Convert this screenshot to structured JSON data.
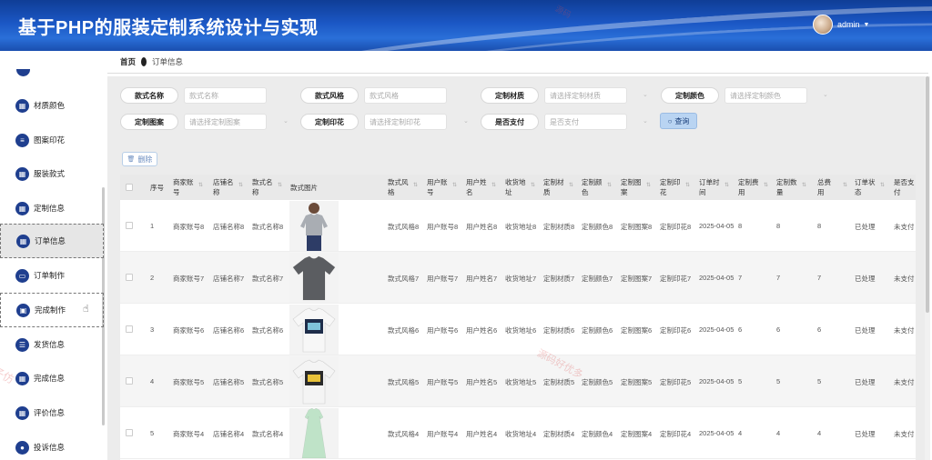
{
  "app": {
    "title": "基于PHP的服装定制系统设计与实现"
  },
  "user": {
    "name": "admin"
  },
  "sidebar": {
    "items": [
      {
        "label": "材质颜色",
        "icon": "grid-icon"
      },
      {
        "label": "图案印花",
        "icon": "list-icon"
      },
      {
        "label": "服装款式",
        "icon": "grid-icon"
      },
      {
        "label": "定制信息",
        "icon": "grid-icon"
      },
      {
        "label": "订单信息",
        "icon": "grid-icon"
      },
      {
        "label": "订单制作",
        "icon": "monitor-icon"
      },
      {
        "label": "完成制作",
        "icon": "clipboard-icon"
      },
      {
        "label": "发货信息",
        "icon": "sliders-icon"
      },
      {
        "label": "完成信息",
        "icon": "grid-icon"
      },
      {
        "label": "评价信息",
        "icon": "grid-icon"
      },
      {
        "label": "投诉信息",
        "icon": "user-icon"
      }
    ]
  },
  "breadcrumb": {
    "home": "首页",
    "current": "订单信息"
  },
  "filters": {
    "style_name": {
      "label": "款式名称",
      "placeholder": "款式名称"
    },
    "style_type": {
      "label": "款式风格",
      "placeholder": "款式风格"
    },
    "material": {
      "label": "定制材质",
      "placeholder": "请选择定制材质"
    },
    "color": {
      "label": "定制颜色",
      "placeholder": "请选择定制颜色"
    },
    "pattern": {
      "label": "定制图案",
      "placeholder": "请选择定制图案"
    },
    "print": {
      "label": "定制印花",
      "placeholder": "请选择定制印花"
    },
    "paid": {
      "label": "是否支付",
      "placeholder": "是否支付"
    },
    "search_label": "查询"
  },
  "toolbar": {
    "delete_label": "删除"
  },
  "table": {
    "headers": [
      [
        "序号"
      ],
      [
        "商家账",
        "号"
      ],
      [
        "店铺名",
        "称"
      ],
      [
        "款式名",
        "称"
      ],
      [
        "款式图片"
      ],
      [
        "款式风",
        "格"
      ],
      [
        "用户账",
        "号"
      ],
      [
        "用户姓",
        "名"
      ],
      [
        "收货地",
        "址"
      ],
      [
        "定制材",
        "质"
      ],
      [
        "定制颜",
        "色"
      ],
      [
        "定制图",
        "案"
      ],
      [
        "定制印",
        "花"
      ],
      [
        "订单时",
        "间"
      ],
      [
        "定制费",
        "用"
      ],
      [
        "定制数",
        "量"
      ],
      [
        "总费",
        "用"
      ],
      [
        "订单状",
        "态"
      ],
      [
        "是否支",
        "付"
      ]
    ],
    "rows": [
      {
        "idx": "1",
        "merchant": "商家账号8",
        "shop": "店铺名称8",
        "style": "款式名称8",
        "image": "gray-womens-tshirt",
        "type": "款式风格8",
        "account": "用户账号8",
        "name": "用户姓名8",
        "addr": "收货地址8",
        "material": "定制材质8",
        "color": "定制颜色8",
        "pattern": "定制图案8",
        "print": "定制印花8",
        "time": "2025-04-05",
        "fee": "8",
        "qty": "8",
        "total": "8",
        "status": "已处理",
        "paid": "未支付"
      },
      {
        "idx": "2",
        "merchant": "商家账号7",
        "shop": "店铺名称7",
        "style": "款式名称7",
        "image": "dark-gray-tshirt",
        "type": "款式风格7",
        "account": "用户账号7",
        "name": "用户姓名7",
        "addr": "收货地址7",
        "material": "定制材质7",
        "color": "定制颜色7",
        "pattern": "定制图案7",
        "print": "定制印花7",
        "time": "2025-04-05",
        "fee": "7",
        "qty": "7",
        "total": "7",
        "status": "已处理",
        "paid": "未支付"
      },
      {
        "idx": "3",
        "merchant": "商家账号6",
        "shop": "店铺名称6",
        "style": "款式名称6",
        "image": "white-printed-tshirt-blue",
        "type": "款式风格6",
        "account": "用户账号6",
        "name": "用户姓名6",
        "addr": "收货地址6",
        "material": "定制材质6",
        "color": "定制颜色6",
        "pattern": "定制图案6",
        "print": "定制印花6",
        "time": "2025-04-05",
        "fee": "6",
        "qty": "6",
        "total": "6",
        "status": "已处理",
        "paid": "未支付"
      },
      {
        "idx": "4",
        "merchant": "商家账号5",
        "shop": "店铺名称5",
        "style": "款式名称5",
        "image": "white-printed-tshirt-yellow",
        "type": "款式风格5",
        "account": "用户账号5",
        "name": "用户姓名5",
        "addr": "收货地址5",
        "material": "定制材质5",
        "color": "定制颜色5",
        "pattern": "定制图案5",
        "print": "定制印花5",
        "time": "2025-04-05",
        "fee": "5",
        "qty": "5",
        "total": "5",
        "status": "已处理",
        "paid": "未支付"
      },
      {
        "idx": "5",
        "merchant": "商家账号4",
        "shop": "店铺名称4",
        "style": "款式名称4",
        "image": "mint-long-dress",
        "type": "款式风格4",
        "account": "用户账号4",
        "name": "用户姓名4",
        "addr": "收货地址4",
        "material": "定制材质4",
        "color": "定制颜色4",
        "pattern": "定制图案4",
        "print": "定制印花4",
        "time": "2025-04-05",
        "fee": "4",
        "qty": "4",
        "total": "4",
        "status": "已处理",
        "paid": "未支付"
      }
    ]
  },
  "watermark": "源码好优多",
  "colors": {
    "header": "#1b57c4",
    "sidebar_icon": "#1f3f8f",
    "search_btn": "#b9d4f2",
    "panel": "#ececec"
  }
}
